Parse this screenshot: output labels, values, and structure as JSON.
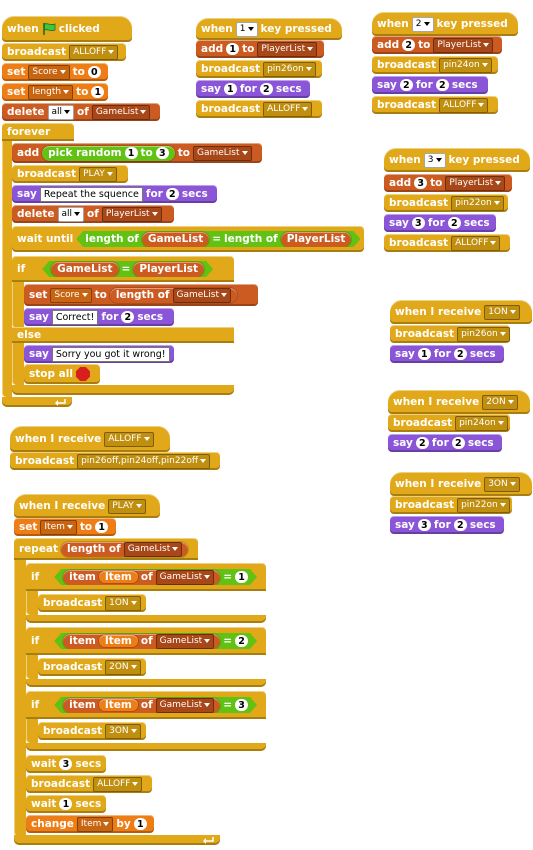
{
  "script1": {
    "hat": {
      "label": "when",
      "label2": "clicked"
    },
    "b1": {
      "label": "broadcast",
      "msg": "ALLOFF"
    },
    "b2": {
      "label": "set",
      "var": "Score",
      "to": "to",
      "value": "0"
    },
    "b3": {
      "label": "set",
      "var": "length",
      "to": "to",
      "value": "1"
    },
    "b4": {
      "label": "delete",
      "which": "all",
      "of": "of",
      "list": "GameList"
    },
    "forever": {
      "label": "forever"
    },
    "f1": {
      "label": "add",
      "reporter": "pick random",
      "a": "1",
      "to_word": "to",
      "b": "3",
      "to": "to",
      "list": "GameList"
    },
    "f2": {
      "label": "broadcast",
      "msg": "PLAY"
    },
    "f3": {
      "label": "say",
      "text": "Repeat the squence",
      "for": "for",
      "secs_val": "2",
      "secs": "secs"
    },
    "f4": {
      "label": "delete",
      "which": "all",
      "of": "of",
      "list": "PlayerList"
    },
    "f5": {
      "label": "wait until",
      "len1": "length of",
      "list1": "GameList",
      "eq": "=",
      "len2": "length of",
      "list2": "PlayerList"
    },
    "f6": {
      "label": "if",
      "left": "GameList",
      "eq": "=",
      "right": "PlayerList"
    },
    "f7": {
      "label": "set",
      "var": "Score",
      "to": "to",
      "len": "length of",
      "list": "GameList"
    },
    "f8": {
      "label": "say",
      "text": "Correct!",
      "for": "for",
      "secs_val": "2",
      "secs": "secs"
    },
    "f9": {
      "label": "else"
    },
    "f10": {
      "label": "say",
      "text": "Sorry you got it wrong!"
    },
    "f11": {
      "label": "stop all"
    }
  },
  "script2": {
    "hat": {
      "label": "when I receive",
      "msg": "ALLOFF"
    },
    "b1": {
      "label": "broadcast",
      "msg": "pin26off,pin24off,pin22off"
    }
  },
  "script3": {
    "hat": {
      "label": "when I receive",
      "msg": "PLAY"
    },
    "b1": {
      "label": "set",
      "var": "Item",
      "to": "to",
      "value": "1"
    },
    "rep": {
      "label": "repeat",
      "len": "length of",
      "list": "GameList"
    },
    "ifs": [
      {
        "label": "if",
        "item": "item",
        "var": "Item",
        "of": "of",
        "list": "GameList",
        "eq": "=",
        "value": "1",
        "bc": "broadcast",
        "msg": "1ON"
      },
      {
        "label": "if",
        "item": "item",
        "var": "Item",
        "of": "of",
        "list": "GameList",
        "eq": "=",
        "value": "2",
        "bc": "broadcast",
        "msg": "2ON"
      },
      {
        "label": "if",
        "item": "item",
        "var": "Item",
        "of": "of",
        "list": "GameList",
        "eq": "=",
        "value": "3",
        "bc": "broadcast",
        "msg": "3ON"
      }
    ],
    "w1": {
      "label": "wait",
      "value": "3",
      "secs": "secs"
    },
    "bc": {
      "label": "broadcast",
      "msg": "ALLOFF"
    },
    "w2": {
      "label": "wait",
      "value": "1",
      "secs": "secs"
    },
    "ch": {
      "label": "change",
      "var": "Item",
      "by": "by",
      "value": "1"
    }
  },
  "key_scripts": [
    {
      "when": "when",
      "key": "1",
      "pressed": "key pressed",
      "add": "add",
      "val": "1",
      "to": "to",
      "list": "PlayerList",
      "bc": "broadcast",
      "pin": "pin26on",
      "say": "say",
      "for": "for",
      "secs_val": "2",
      "secs": "secs",
      "bc2": "broadcast",
      "off": "ALLOFF"
    },
    {
      "when": "when",
      "key": "2",
      "pressed": "key pressed",
      "add": "add",
      "val": "2",
      "to": "to",
      "list": "PlayerList",
      "bc": "broadcast",
      "pin": "pin24on",
      "say": "say",
      "for": "for",
      "secs_val": "2",
      "secs": "secs",
      "bc2": "broadcast",
      "off": "ALLOFF"
    },
    {
      "when": "when",
      "key": "3",
      "pressed": "key pressed",
      "add": "add",
      "val": "3",
      "to": "to",
      "list": "PlayerList",
      "bc": "broadcast",
      "pin": "pin22on",
      "say": "say",
      "for": "for",
      "secs_val": "2",
      "secs": "secs",
      "bc2": "broadcast",
      "off": "ALLOFF"
    }
  ],
  "receive_scripts": [
    {
      "hat": "when I receive",
      "msg": "1ON",
      "bc": "broadcast",
      "pin": "pin26on",
      "say": "say",
      "val": "1",
      "for": "for",
      "secs_val": "2",
      "secs": "secs"
    },
    {
      "hat": "when I receive",
      "msg": "2ON",
      "bc": "broadcast",
      "pin": "pin24on",
      "say": "say",
      "val": "2",
      "for": "for",
      "secs_val": "2",
      "secs": "secs"
    },
    {
      "hat": "when I receive",
      "msg": "3ON",
      "bc": "broadcast",
      "pin": "pin22on",
      "say": "say",
      "val": "3",
      "for": "for",
      "secs_val": "2",
      "secs": "secs"
    }
  ],
  "colors": {
    "control": "#e1a91a",
    "variables": "#ee7d16",
    "lists": "#cc5b22",
    "looks": "#8a55d7",
    "operators": "#62c213",
    "flag": "#3ec63e",
    "stop": "#d81e1e"
  }
}
